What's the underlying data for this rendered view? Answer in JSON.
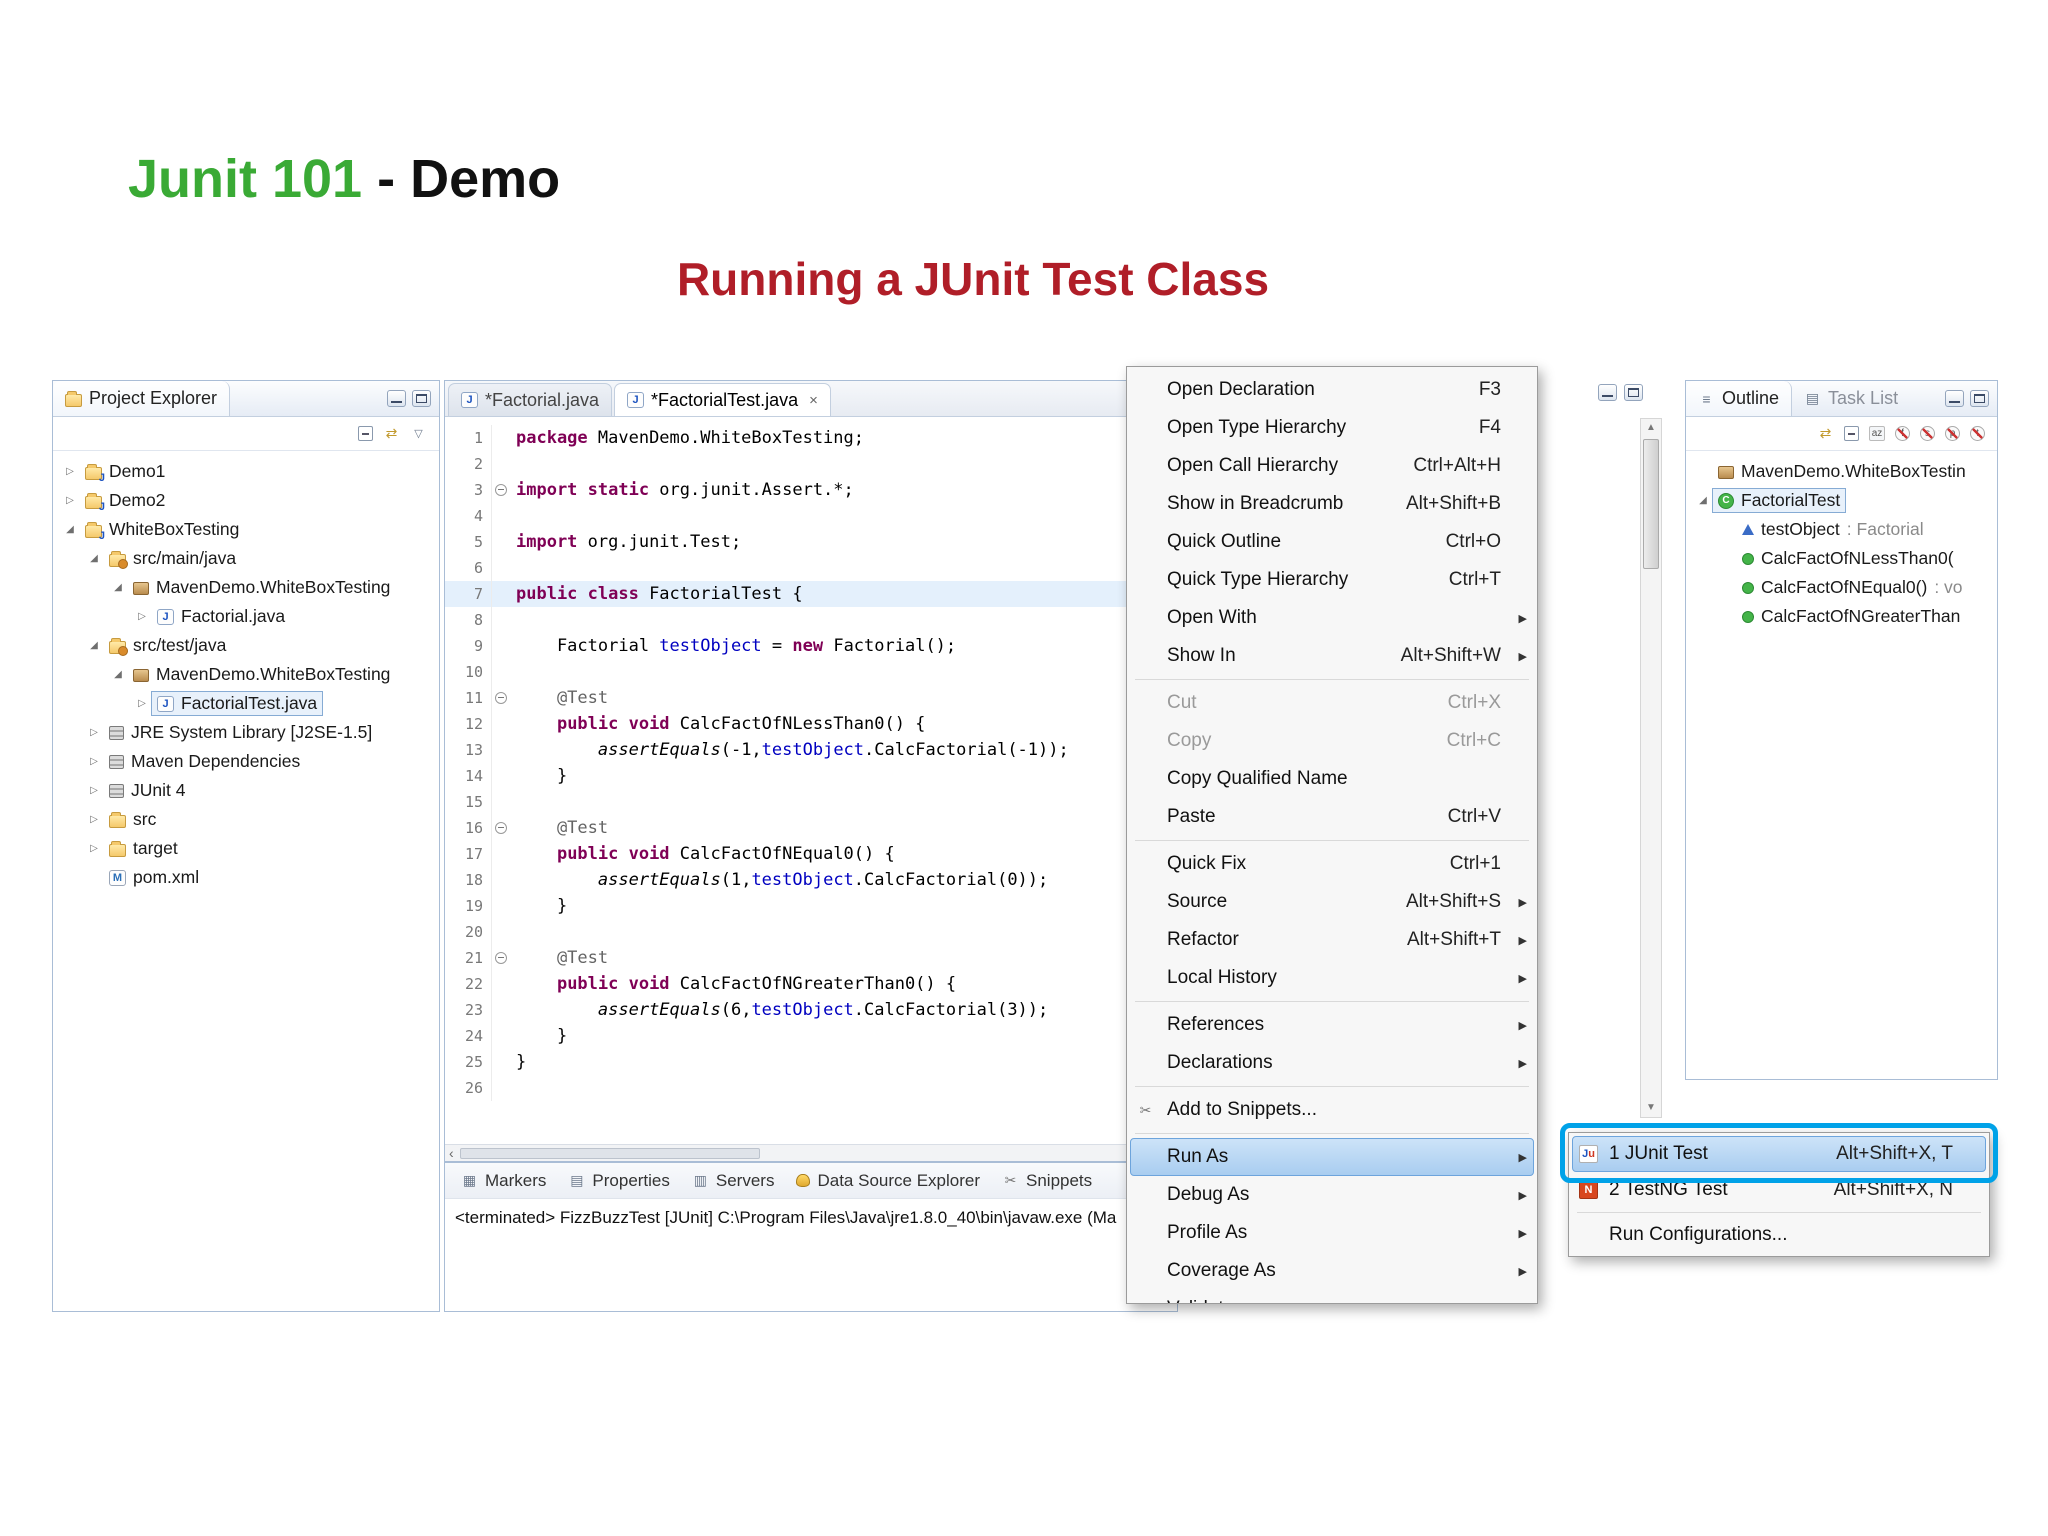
{
  "slide": {
    "title_primary": "Junit 101",
    "title_secondary": " - Demo",
    "subtitle": "Running a JUnit Test Class",
    "colors": {
      "title_green": "#3aaa35",
      "subtitle_red": "#b01e28",
      "annotation_cyan": "#00a2e8"
    }
  },
  "project_explorer": {
    "title": "Project Explorer",
    "toolbar_icons": [
      "collapse-all-icon",
      "link-with-editor-icon",
      "view-menu-icon"
    ],
    "tree": [
      {
        "label": "Demo1",
        "icon": "java-project-icon",
        "depth": 0,
        "arrow": "collapsed"
      },
      {
        "label": "Demo2",
        "icon": "java-project-icon",
        "depth": 0,
        "arrow": "collapsed"
      },
      {
        "label": "WhiteBoxTesting",
        "icon": "java-project-icon",
        "depth": 0,
        "arrow": "expanded"
      },
      {
        "label": "src/main/java",
        "icon": "src-folder-icon",
        "depth": 1,
        "arrow": "expanded"
      },
      {
        "label": "MavenDemo.WhiteBoxTesting",
        "icon": "package-icon",
        "depth": 2,
        "arrow": "expanded"
      },
      {
        "label": "Factorial.java",
        "icon": "java-file-icon",
        "depth": 3,
        "arrow": "collapsed"
      },
      {
        "label": "src/test/java",
        "icon": "src-folder-icon",
        "depth": 1,
        "arrow": "expanded"
      },
      {
        "label": "MavenDemo.WhiteBoxTesting",
        "icon": "package-icon",
        "depth": 2,
        "arrow": "expanded"
      },
      {
        "label": "FactorialTest.java",
        "icon": "java-file-icon",
        "depth": 3,
        "arrow": "collapsed",
        "selected": true
      },
      {
        "label": "JRE System Library [J2SE-1.5]",
        "icon": "library-icon",
        "depth": 1,
        "arrow": "collapsed"
      },
      {
        "label": "Maven Dependencies",
        "icon": "library-icon",
        "depth": 1,
        "arrow": "collapsed"
      },
      {
        "label": "JUnit 4",
        "icon": "library-icon",
        "depth": 1,
        "arrow": "collapsed"
      },
      {
        "label": "src",
        "icon": "folder-icon",
        "depth": 1,
        "arrow": "collapsed"
      },
      {
        "label": "target",
        "icon": "folder-icon",
        "depth": 1,
        "arrow": "collapsed"
      },
      {
        "label": "pom.xml",
        "icon": "pom-icon",
        "depth": 1,
        "arrow": "none"
      }
    ]
  },
  "editor": {
    "tabs": [
      {
        "label": "*Factorial.java",
        "icon": "java-file-icon",
        "active": false
      },
      {
        "label": "*FactorialTest.java",
        "icon": "java-file-icon",
        "active": true,
        "closable": true
      }
    ],
    "lines": [
      {
        "num": "1",
        "segs": [
          [
            "k",
            "package"
          ],
          [
            "p",
            " MavenDemo.WhiteBoxTesting;"
          ]
        ]
      },
      {
        "num": "2",
        "segs": []
      },
      {
        "num": "3",
        "fold": true,
        "segs": [
          [
            "k",
            "import static"
          ],
          [
            "p",
            " org.junit.Assert.*;"
          ]
        ]
      },
      {
        "num": "4",
        "segs": []
      },
      {
        "num": "5",
        "segs": [
          [
            "k",
            "import"
          ],
          [
            "p",
            " org.junit.Test;"
          ]
        ]
      },
      {
        "num": "6",
        "segs": []
      },
      {
        "num": "7",
        "hl": true,
        "segs": [
          [
            "k",
            "public class"
          ],
          [
            "p",
            " FactorialTest {"
          ]
        ]
      },
      {
        "num": "8",
        "segs": []
      },
      {
        "num": "9",
        "segs": [
          [
            "p",
            "    Factorial "
          ],
          [
            "f",
            "testObject"
          ],
          [
            "p",
            " = "
          ],
          [
            "k",
            "new"
          ],
          [
            "p",
            " Factorial();"
          ]
        ]
      },
      {
        "num": "10",
        "segs": []
      },
      {
        "num": "11",
        "fold": true,
        "segs": [
          [
            "a",
            "    @Test"
          ]
        ]
      },
      {
        "num": "12",
        "segs": [
          [
            "p",
            "    "
          ],
          [
            "k",
            "public void"
          ],
          [
            "p",
            " CalcFactOfNLessThan0() {"
          ]
        ]
      },
      {
        "num": "13",
        "segs": [
          [
            "p",
            "        "
          ],
          [
            "s",
            "assertEquals"
          ],
          [
            "p",
            "(-1,"
          ],
          [
            "f",
            "testObject"
          ],
          [
            "p",
            ".CalcFactorial(-1));"
          ]
        ]
      },
      {
        "num": "14",
        "segs": [
          [
            "p",
            "    }"
          ]
        ]
      },
      {
        "num": "15",
        "segs": []
      },
      {
        "num": "16",
        "fold": true,
        "segs": [
          [
            "a",
            "    @Test"
          ]
        ]
      },
      {
        "num": "17",
        "segs": [
          [
            "p",
            "    "
          ],
          [
            "k",
            "public void"
          ],
          [
            "p",
            " CalcFactOfNEqual0() {"
          ]
        ]
      },
      {
        "num": "18",
        "segs": [
          [
            "p",
            "        "
          ],
          [
            "s",
            "assertEquals"
          ],
          [
            "p",
            "(1,"
          ],
          [
            "f",
            "testObject"
          ],
          [
            "p",
            ".CalcFactorial(0));"
          ]
        ]
      },
      {
        "num": "19",
        "segs": [
          [
            "p",
            "    }"
          ]
        ]
      },
      {
        "num": "20",
        "segs": []
      },
      {
        "num": "21",
        "fold": true,
        "segs": [
          [
            "a",
            "    @Test"
          ]
        ]
      },
      {
        "num": "22",
        "segs": [
          [
            "p",
            "    "
          ],
          [
            "k",
            "public void"
          ],
          [
            "p",
            " CalcFactOfNGreaterThan0() {"
          ]
        ]
      },
      {
        "num": "23",
        "segs": [
          [
            "p",
            "        "
          ],
          [
            "s",
            "assertEquals"
          ],
          [
            "p",
            "(6,"
          ],
          [
            "f",
            "testObject"
          ],
          [
            "p",
            ".CalcFactorial(3));"
          ]
        ]
      },
      {
        "num": "24",
        "segs": [
          [
            "p",
            "    }"
          ]
        ]
      },
      {
        "num": "25",
        "segs": [
          [
            "p",
            "}"
          ]
        ]
      },
      {
        "num": "26",
        "segs": []
      }
    ]
  },
  "context_menu": {
    "groups": [
      {
        "items": [
          {
            "label": "Open Declaration",
            "shortcut": "F3"
          },
          {
            "label": "Open Type Hierarchy",
            "shortcut": "F4"
          },
          {
            "label": "Open Call Hierarchy",
            "shortcut": "Ctrl+Alt+H"
          },
          {
            "label": "Show in Breadcrumb",
            "shortcut": "Alt+Shift+B"
          },
          {
            "label": "Quick Outline",
            "shortcut": "Ctrl+O"
          },
          {
            "label": "Quick Type Hierarchy",
            "shortcut": "Ctrl+T"
          },
          {
            "label": "Open With",
            "submenu": true
          },
          {
            "label": "Show In",
            "shortcut": "Alt+Shift+W",
            "submenu": true
          }
        ]
      },
      {
        "items": [
          {
            "label": "Cut",
            "shortcut": "Ctrl+X",
            "disabled": true
          },
          {
            "label": "Copy",
            "shortcut": "Ctrl+C",
            "disabled": true
          },
          {
            "label": "Copy Qualified Name"
          },
          {
            "label": "Paste",
            "shortcut": "Ctrl+V"
          }
        ]
      },
      {
        "items": [
          {
            "label": "Quick Fix",
            "shortcut": "Ctrl+1"
          },
          {
            "label": "Source",
            "shortcut": "Alt+Shift+S",
            "submenu": true
          },
          {
            "label": "Refactor",
            "shortcut": "Alt+Shift+T",
            "submenu": true
          },
          {
            "label": "Local History",
            "submenu": true
          }
        ]
      },
      {
        "items": [
          {
            "label": "References",
            "submenu": true
          },
          {
            "label": "Declarations",
            "submenu": true
          }
        ]
      },
      {
        "items": [
          {
            "label": "Add to Snippets...",
            "icon": "snippets-icon"
          }
        ]
      },
      {
        "items": [
          {
            "label": "Run As",
            "submenu": true,
            "selected": true
          },
          {
            "label": "Debug As",
            "submenu": true
          },
          {
            "label": "Profile As",
            "submenu": true
          },
          {
            "label": "Coverage As",
            "submenu": true
          },
          {
            "label": "Validate"
          }
        ]
      }
    ]
  },
  "run_as_submenu": {
    "items": [
      {
        "label": "1 JUnit Test",
        "shortcut": "Alt+Shift+X, T",
        "icon": "junit-icon",
        "selected": true
      },
      {
        "label": "2 TestNG Test",
        "shortcut": "Alt+Shift+X, N",
        "icon": "testng-icon"
      },
      {
        "separator": true
      },
      {
        "label": "Run Configurations..."
      }
    ]
  },
  "outline": {
    "tabs": [
      {
        "label": "Outline",
        "icon": "outline-icon",
        "active": true
      },
      {
        "label": "Task List",
        "icon": "task-list-icon",
        "active": false
      }
    ],
    "toolbar_icons": [
      "link-with-editor-icon",
      "collapse-all-icon",
      "sort-icon",
      "hide-fields-icon",
      "hide-static-members-icon",
      "hide-non-public-icon",
      "hide-local-types-icon"
    ],
    "tree": [
      {
        "label": "MavenDemo.WhiteBoxTestin",
        "icon": "package-icon",
        "depth": 0,
        "arrow": "none"
      },
      {
        "label": "FactorialTest",
        "icon": "class-icon",
        "depth": 0,
        "arrow": "expanded",
        "selected": true
      },
      {
        "label": "testObject",
        "suffix": " : Factorial",
        "icon": "field-icon",
        "depth": 1,
        "arrow": "none"
      },
      {
        "label": "CalcFactOfNLessThan0(",
        "icon": "method-icon",
        "depth": 1,
        "arrow": "none"
      },
      {
        "label": "CalcFactOfNEqual0()",
        "suffix": " : vo",
        "icon": "method-icon",
        "depth": 1,
        "arrow": "none"
      },
      {
        "label": "CalcFactOfNGreaterThan",
        "icon": "method-icon",
        "depth": 1,
        "arrow": "none"
      }
    ]
  },
  "console": {
    "tabs": [
      {
        "label": "Markers",
        "icon": "markers-icon"
      },
      {
        "label": "Properties",
        "icon": "properties-icon"
      },
      {
        "label": "Servers",
        "icon": "servers-icon"
      },
      {
        "label": "Data Source Explorer",
        "icon": "data-source-icon"
      },
      {
        "label": "Snippets",
        "icon": "snippets-icon"
      }
    ],
    "status_text": "<terminated> FizzBuzzTest [JUnit] C:\\Program Files\\Java\\jre1.8.0_40\\bin\\javaw.exe (Ma"
  }
}
